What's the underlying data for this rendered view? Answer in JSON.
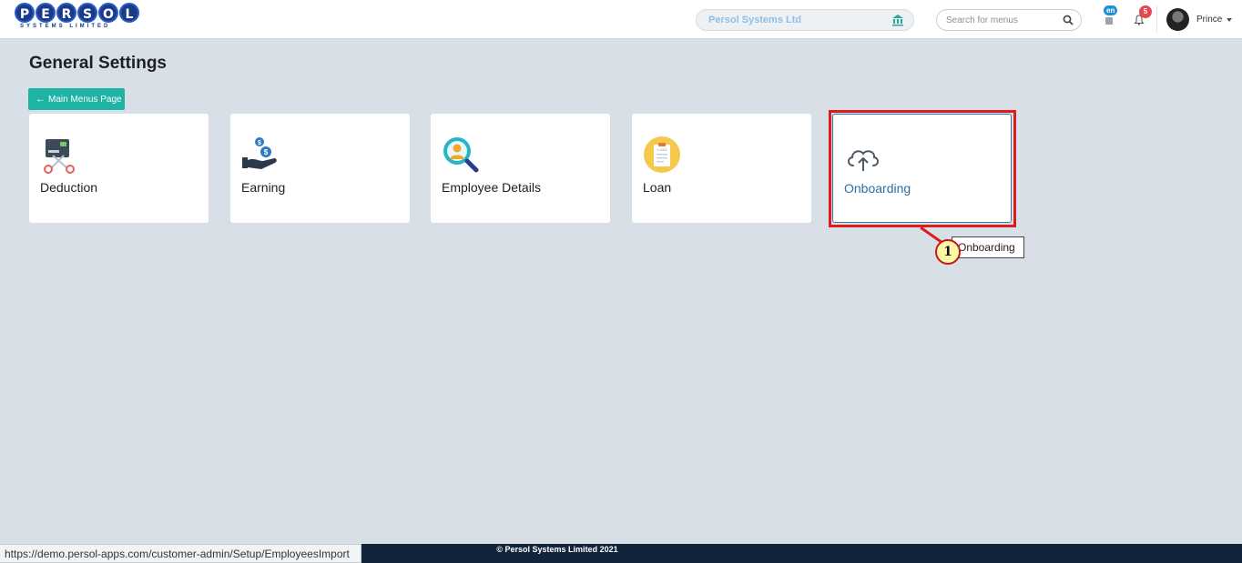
{
  "header": {
    "logo_letters": [
      "P",
      "E",
      "R",
      "S",
      "O",
      "L"
    ],
    "logo_subtitle": "SYSTEMS LIMITED",
    "org_name": "Persol Systems Ltd",
    "search_placeholder": "Search for menus",
    "language_badge": "en",
    "notification_count": "5",
    "user_name": "Prince"
  },
  "main": {
    "page_title": "General Settings",
    "back_button_label": "Main Menus Page",
    "cards": [
      {
        "label": "Deduction",
        "icon": "deduction-icon"
      },
      {
        "label": "Earning",
        "icon": "earning-icon"
      },
      {
        "label": "Employee Details",
        "icon": "employee-details-icon"
      },
      {
        "label": "Loan",
        "icon": "loan-icon"
      },
      {
        "label": "Onboarding",
        "icon": "cloud-upload-icon"
      }
    ]
  },
  "annotation": {
    "step_number": "1",
    "tooltip_text": "Onboarding"
  },
  "footer": {
    "copyright": "© Persol Systems Limited 2021"
  },
  "status_bar": {
    "url": "https://demo.persol-apps.com/customer-admin/Setup/EmployeesImport"
  },
  "colors": {
    "accent_teal": "#1fb3a6",
    "highlight_red": "#e01b1b",
    "footer_navy": "#12243a",
    "background": "#d9dfe7"
  },
  "icon_names": {
    "logo": "persol-logo",
    "org": "bank-icon",
    "search": "search-icon",
    "language": "language-icon",
    "bell": "bell-icon",
    "back": "arrow-left-icon"
  }
}
